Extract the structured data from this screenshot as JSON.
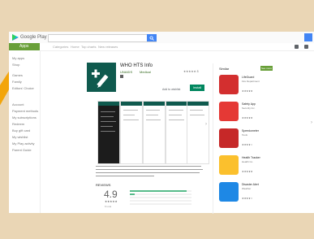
{
  "header": {
    "brand": "Google Play"
  },
  "nav": {
    "apps_tab": "Apps",
    "categories": [
      "Categories",
      "Home",
      "Top charts",
      "New releases"
    ]
  },
  "sidebar": {
    "items": [
      "My apps",
      "Shop",
      "Games",
      "Family",
      "Editors' Choice",
      "Account",
      "Payment methods",
      "My subscriptions",
      "Redeem",
      "Buy gift card",
      "My wishlist",
      "My Play activity",
      "Parent Guide"
    ]
  },
  "app": {
    "title": "WHO HTS Info",
    "developer": "UNAIDS",
    "category": "Medical",
    "rating_header": "★★★★★ 8",
    "wishlist": "Add to wishlist",
    "install": "Install"
  },
  "reviews": {
    "title": "REVIEWS",
    "rating": "4.9",
    "stars": "★★★★★",
    "count": "8 total",
    "bars": [
      0.92,
      0.08,
      0,
      0,
      0
    ]
  },
  "similar": {
    "title": "Similar",
    "see_more": "See more",
    "items": [
      {
        "name": "LifeGuard",
        "dev": "Fire Department",
        "stars": "★★★★★",
        "color": "#d32f2f"
      },
      {
        "name": "Safety App",
        "dev": "Security Inc.",
        "stars": "★★★★★",
        "color": "#e53935"
      },
      {
        "name": "Speedometer",
        "dev": "Tools",
        "stars": "★★★★☆",
        "color": "#c62828"
      },
      {
        "name": "Health Tracker",
        "dev": "Health Co",
        "stars": "★★★★★",
        "color": "#fbc02d"
      },
      {
        "name": "Disaster Alert",
        "dev": "Weather",
        "stars": "★★★★☆",
        "color": "#1e88e5"
      }
    ]
  }
}
